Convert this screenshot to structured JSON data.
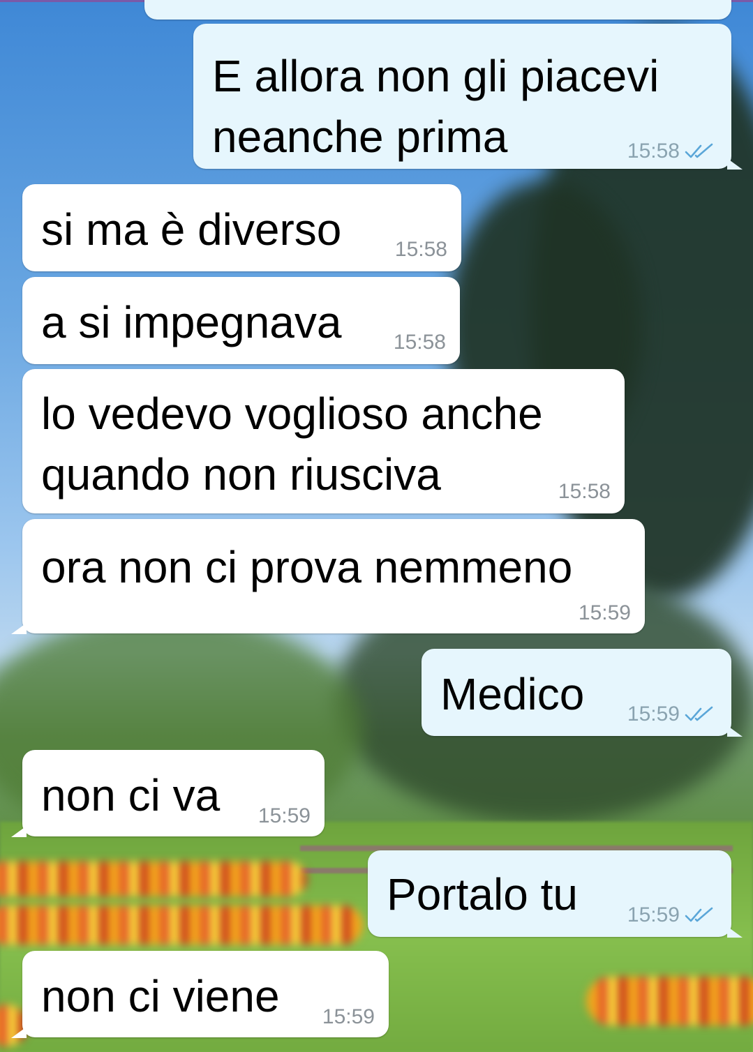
{
  "messages": [
    {
      "id": "m1",
      "direction": "outgoing",
      "text_lines": [
        "E allora non gli piacevi",
        "neanche prima"
      ],
      "time": "15:58",
      "status": "read"
    },
    {
      "id": "m2",
      "direction": "incoming",
      "text_lines": [
        "si ma è diverso"
      ],
      "time": "15:58"
    },
    {
      "id": "m3",
      "direction": "incoming",
      "text_lines": [
        "a si impegnava"
      ],
      "time": "15:58"
    },
    {
      "id": "m4",
      "direction": "incoming",
      "text_lines": [
        "lo vedevo voglioso anche",
        "quando non riusciva"
      ],
      "time": "15:58"
    },
    {
      "id": "m5",
      "direction": "incoming",
      "text_lines": [
        "ora non ci prova nemmeno"
      ],
      "time": "15:59"
    },
    {
      "id": "m6",
      "direction": "outgoing",
      "text_lines": [
        "Medico"
      ],
      "time": "15:59",
      "status": "read"
    },
    {
      "id": "m7",
      "direction": "incoming",
      "text_lines": [
        "non ci va"
      ],
      "time": "15:59"
    },
    {
      "id": "m8",
      "direction": "outgoing",
      "text_lines": [
        "Portalo tu"
      ],
      "time": "15:59",
      "status": "read"
    },
    {
      "id": "m9",
      "direction": "incoming",
      "text_lines": [
        "non ci viene"
      ],
      "time": "15:59"
    }
  ],
  "icons": {
    "read_receipt": "double-check-icon"
  },
  "colors": {
    "outgoing_bubble": "#e6f6fd",
    "incoming_bubble": "#ffffff",
    "read_tick": "#5aa6d8",
    "timestamp": "#8b9298"
  }
}
